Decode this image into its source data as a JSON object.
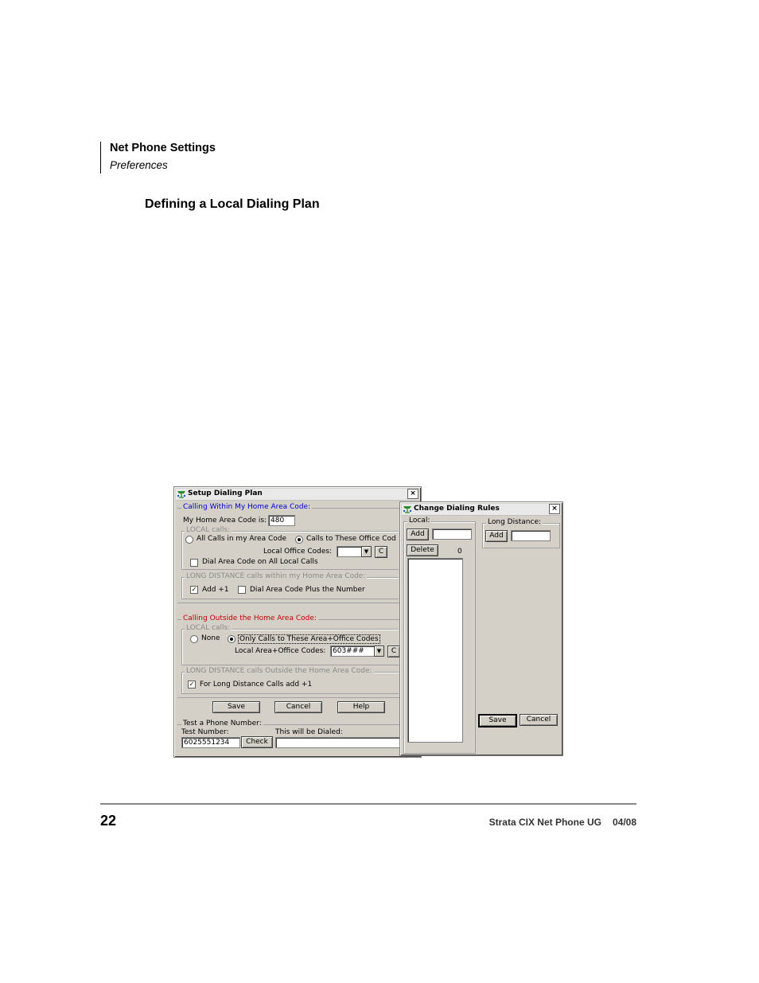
{
  "header": {
    "title": "Net Phone Settings",
    "subtitle": "Preferences"
  },
  "section_title": "Defining a Local Dialing Plan",
  "footer": {
    "page_number": "22",
    "doc_title": "Strata CIX Net Phone UG",
    "doc_date": "04/08"
  },
  "setup_dialog": {
    "title": "Setup Dialing Plan",
    "close": "×",
    "home_group_label": "Calling Within My Home Area Code:",
    "home_area_label": "My Home Area Code is:",
    "home_area_value": "480",
    "local_calls_label": "LOCAL calls:",
    "all_calls_label": "All Calls in my Area Code",
    "these_codes_label": "Calls to These Office Cod",
    "local_office_label": "Local Office Codes:",
    "local_office_value": "",
    "dial_area_label": "Dial Area Code on All Local Calls",
    "ld_within_label": "LONG DISTANCE calls within my Home Area Code:",
    "add1_label": "Add +1",
    "dial_plus_label": "Dial Area Code Plus the Number",
    "outside_group_label": "Calling Outside the Home Area Code:",
    "outside_local_label": "LOCAL calls:",
    "none_label": "None",
    "only_calls_label": "Only Calls to These Area+Office Codes",
    "local_area_office_label": "Local Area+Office Codes:",
    "local_area_office_value": "603###",
    "ld_outside_label": "LONG DISTANCE calls Outside the Home Area Code:",
    "ld_add1_label": "For Long Distance Calls add +1",
    "c_button": "C",
    "save_button": "Save",
    "cancel_button": "Cancel",
    "help_button": "Help",
    "test_label": "Test a Phone Number:",
    "test_number_label": "Test Number:",
    "dialed_label": "This will be Dialed:",
    "test_number_value": "6025551234",
    "check_button": "Check",
    "dialed_value": ""
  },
  "rules_dialog": {
    "title": "Change Dialing Rules",
    "close": "×",
    "local_label": "Local:",
    "add_button": "Add",
    "delete_button": "Delete",
    "count": "0",
    "long_distance_label": "Long Distance:",
    "ld_add_button": "Add",
    "save_button": "Save",
    "cancel_button": "Cancel"
  }
}
